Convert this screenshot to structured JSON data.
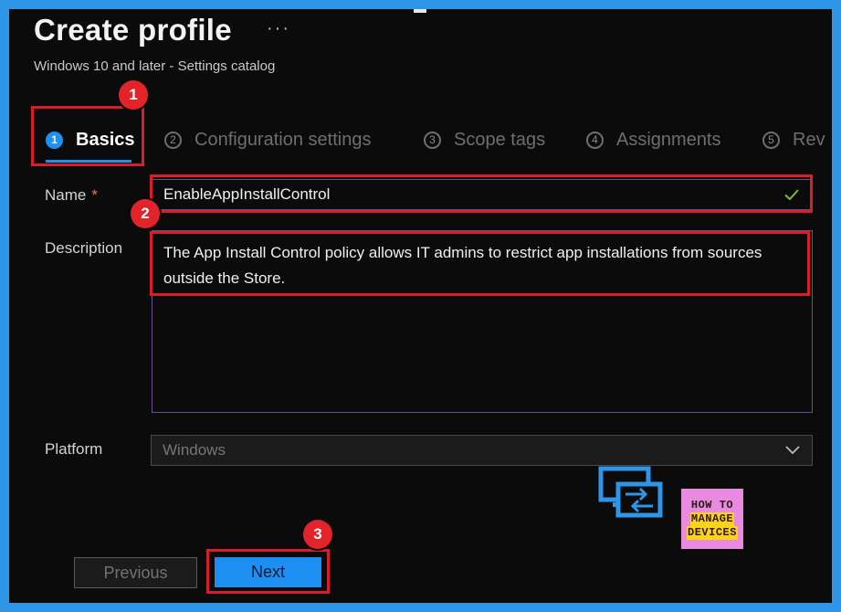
{
  "header": {
    "title": "Create profile",
    "more": "···",
    "subtitle": "Windows 10 and later - Settings catalog"
  },
  "tabs": [
    {
      "number": "1",
      "label": "Basics",
      "active": true
    },
    {
      "number": "2",
      "label": "Configuration settings",
      "active": false
    },
    {
      "number": "3",
      "label": "Scope tags",
      "active": false
    },
    {
      "number": "4",
      "label": "Assignments",
      "active": false
    },
    {
      "number": "5",
      "label": "Rev",
      "active": false
    }
  ],
  "form": {
    "name_label": "Name",
    "required_marker": "*",
    "name_value": "EnableAppInstallControl",
    "description_label": "Description",
    "description_value": "The App Install Control policy allows IT admins to restrict app installations from sources outside the Store.",
    "platform_label": "Platform",
    "platform_value": "Windows"
  },
  "buttons": {
    "previous": "Previous",
    "next": "Next"
  },
  "annotations": {
    "badge1": "1",
    "badge2": "2",
    "badge3": "3"
  },
  "logo": {
    "line1": "HOW TO",
    "line2": "MANAGE",
    "line3": "DEVICES"
  },
  "colors": {
    "accent": "#1f8ff0",
    "highlight": "#d81e28",
    "input_border": "#6b4d9a",
    "valid_check": "#7fba3c"
  }
}
